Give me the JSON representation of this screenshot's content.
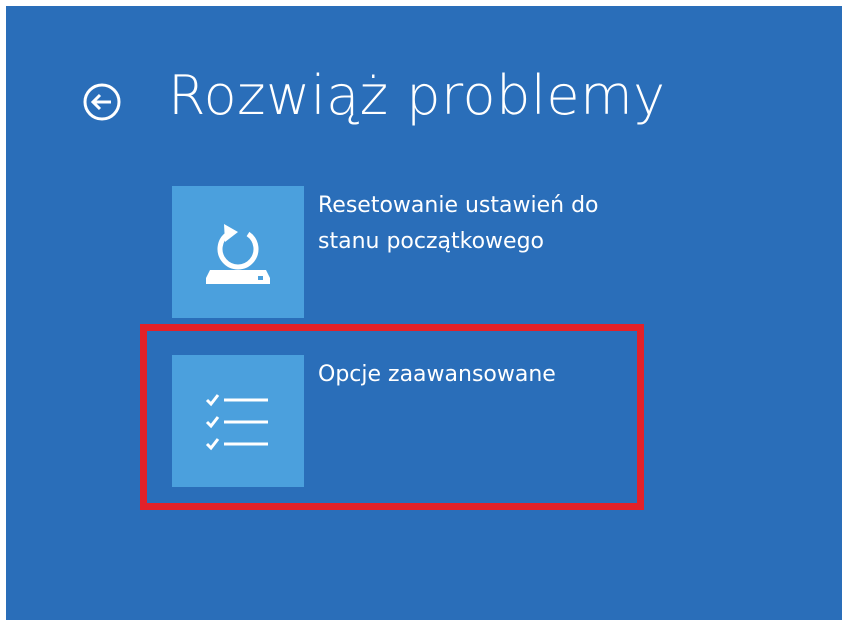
{
  "header": {
    "title": "Rozwiąż problemy",
    "back_icon": "back-arrow-circle-icon"
  },
  "options": [
    {
      "label": "Resetowanie ustawień do stanu początkowego",
      "icon": "reset-pc-icon"
    },
    {
      "label": "Opcje zaawansowane",
      "icon": "checklist-icon"
    }
  ],
  "colors": {
    "background": "#2a6eb9",
    "tile": "#4ba0dd",
    "text": "#ffffff",
    "highlight": "#e32129"
  }
}
